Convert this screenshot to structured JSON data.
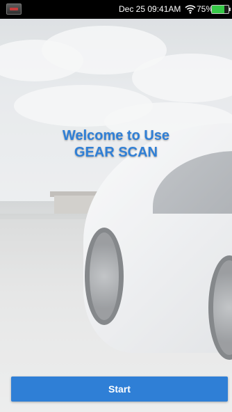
{
  "status_bar": {
    "datetime": "Dec 25 09:41AM",
    "battery_percent": "75%",
    "battery_level": 0.75,
    "icons": [
      "app-icon",
      "wifi-icon",
      "battery-icon"
    ],
    "battery_color": "#36c847"
  },
  "welcome": {
    "line1": "Welcome to Use",
    "line2": "GEAR SCAN",
    "color": "#2f7fd6"
  },
  "start_button": {
    "label": "Start",
    "color": "#2f7fd6"
  }
}
